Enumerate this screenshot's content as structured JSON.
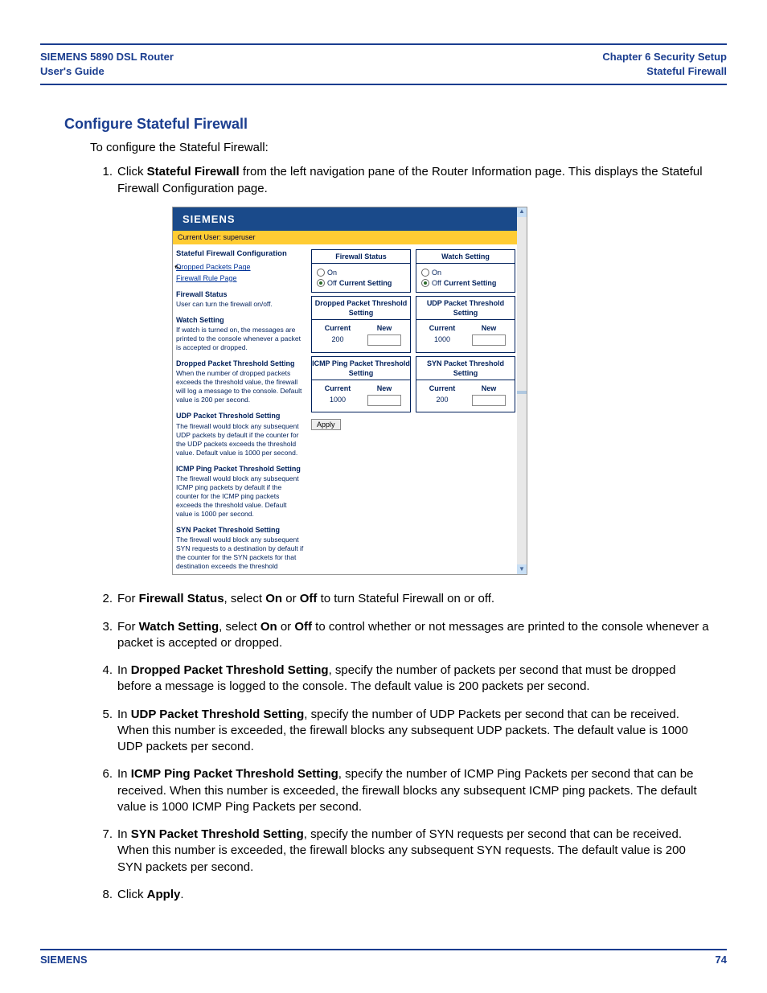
{
  "header": {
    "left_line1": "SIEMENS 5890 DSL Router",
    "left_line2": "User's Guide",
    "right_line1": "Chapter 6  Security Setup",
    "right_line2": "Stateful Firewall"
  },
  "section_title": "Configure Stateful Firewall",
  "intro": "To configure the Stateful Firewall:",
  "steps": {
    "s1a": "Click ",
    "s1b": "Stateful Firewall",
    "s1c": " from the left navigation pane of the Router Information page. This displays the Stateful Firewall Configuration page.",
    "s2a": "For ",
    "s2b": "Firewall Status",
    "s2c": ", select ",
    "s2d": "On",
    "s2e": " or ",
    "s2f": "Off",
    "s2g": " to turn Stateful Firewall on or off.",
    "s3a": "For ",
    "s3b": "Watch Setting",
    "s3c": ", select ",
    "s3d": "On",
    "s3e": " or ",
    "s3f": "Off",
    "s3g": " to control whether or not messages are printed to the console whenever a packet is accepted or dropped.",
    "s4a": "In ",
    "s4b": "Dropped Packet Threshold Setting",
    "s4c": ", specify the number of packets per second that must be dropped before a message is logged to the console. The default value is 200 packets per second.",
    "s5a": "In ",
    "s5b": "UDP Packet Threshold Setting",
    "s5c": ", specify the number of UDP Packets per second that can be received. When this number is exceeded, the firewall blocks any subsequent UDP packets. The default value is 1000 UDP packets per second.",
    "s6a": "In ",
    "s6b": "ICMP Ping Packet Threshold Setting",
    "s6c": ", specify the number of ICMP Ping Packets per second that can be received. When this number is exceeded, the firewall blocks any subsequent ICMP ping packets. The default value is 1000 ICMP Ping Packets per second.",
    "s7a": "In ",
    "s7b": "SYN Packet Threshold Setting",
    "s7c": ", specify the number of SYN requests per second that can be received. When this number is exceeded, the firewall blocks any subsequent SYN requests. The default value is 200 SYN packets per second.",
    "s8a": "Click ",
    "s8b": "Apply",
    "s8c": "."
  },
  "ss": {
    "brand": "SIEMENS",
    "user": "Current User: superuser",
    "side_title": "Stateful Firewall Configuration",
    "link1": "Dropped Packets Page",
    "link2": "Firewall Rule Page",
    "h1": "Firewall Status",
    "t1": "User can turn the firewall on/off.",
    "h2": "Watch Setting",
    "t2": "If watch is turned on, the messages are printed to the console whenever a packet is accepted or dropped.",
    "h3": "Dropped Packet Threshold Setting",
    "t3": "When the number of dropped packets exceeds the threshold value, the firewall will log a message to the console. Default value is 200 per second.",
    "h4": "UDP Packet Threshold Setting",
    "t4": "The firewall would block any subsequent UDP packets by default if the counter for the UDP packets exceeds the threshold value. Default value is 1000 per second.",
    "h5": "ICMP Ping Packet Threshold Setting",
    "t5": "The firewall would block any subsequent ICMP ping packets by default if the counter for the ICMP ping packets exceeds the threshold value. Default value is 1000 per second.",
    "h6": "SYN Packet Threshold Setting",
    "t6": "The firewall would block any subsequent SYN requests to a destination by default if the counter for the SYN packets for that destination exceeds the threshold",
    "p_fw": "Firewall Status",
    "p_watch": "Watch Setting",
    "p_drop": "Dropped Packet Threshold Setting",
    "p_udp": "UDP Packet Threshold Setting",
    "p_icmp": "ICMP Ping Packet Threshold Setting",
    "p_syn": "SYN Packet Threshold Setting",
    "on": "On",
    "off": "Off",
    "curset": "Current Setting",
    "current": "Current",
    "new": "New",
    "v200": "200",
    "v1000": "1000",
    "apply": "Apply"
  },
  "footer": {
    "brand": "SIEMENS",
    "page": "74"
  }
}
